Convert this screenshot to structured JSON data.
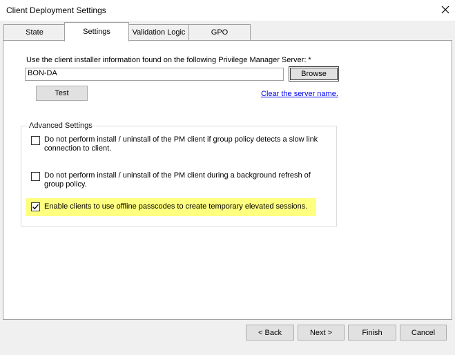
{
  "window": {
    "title": "Client Deployment Settings",
    "close_icon": "close-icon"
  },
  "tabs": [
    {
      "label": "State",
      "active": false
    },
    {
      "label": "Settings",
      "active": true
    },
    {
      "label": "Validation Logic",
      "active": false
    },
    {
      "label": "GPO",
      "active": false
    }
  ],
  "settings": {
    "server_label": "Use the client installer information found on the following Privilege Manager Server: *",
    "server_value": "BON-DA",
    "browse_label": "Browse",
    "test_label": "Test",
    "clear_link": "Clear the server name.",
    "advanced": {
      "legend": "Advanced Settings",
      "options": [
        {
          "label_line1": "Do not perform install / uninstall of the PM client if group policy detects a slow link",
          "label_line2": "connection to client.",
          "checked": false
        },
        {
          "label_line1": "Do not perform install / uninstall of the PM client during a background refresh of",
          "label_line2": "group policy.",
          "checked": false
        },
        {
          "label_line1": "Enable clients to use offline passcodes to create temporary elevated sessions.",
          "label_line2": "",
          "checked": true,
          "highlight_color": "#ffff80"
        }
      ]
    }
  },
  "footer": {
    "back_label": "< Back",
    "next_label": "Next >",
    "finish_label": "Finish",
    "cancel_label": "Cancel"
  }
}
